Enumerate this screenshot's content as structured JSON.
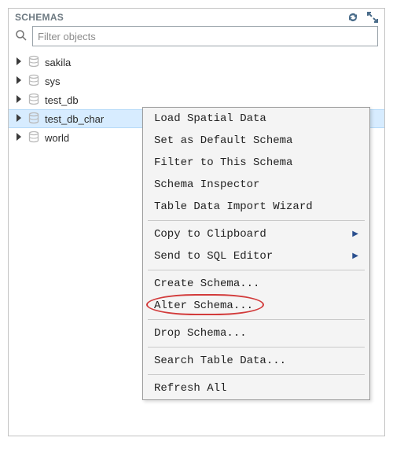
{
  "header": {
    "title": "SCHEMAS"
  },
  "search": {
    "placeholder": "Filter objects"
  },
  "schemas": [
    {
      "name": "sakila",
      "selected": false
    },
    {
      "name": "sys",
      "selected": false
    },
    {
      "name": "test_db",
      "selected": false
    },
    {
      "name": "test_db_char",
      "selected": true
    },
    {
      "name": "world",
      "selected": false
    }
  ],
  "context_menu": {
    "sections": [
      [
        {
          "label": "Load Spatial Data",
          "submenu": false,
          "highlight": false
        },
        {
          "label": "Set as Default Schema",
          "submenu": false,
          "highlight": false
        },
        {
          "label": "Filter to This Schema",
          "submenu": false,
          "highlight": false
        },
        {
          "label": "Schema Inspector",
          "submenu": false,
          "highlight": false
        },
        {
          "label": "Table Data Import Wizard",
          "submenu": false,
          "highlight": false
        }
      ],
      [
        {
          "label": "Copy to Clipboard",
          "submenu": true,
          "highlight": false
        },
        {
          "label": "Send to SQL Editor",
          "submenu": true,
          "highlight": false
        }
      ],
      [
        {
          "label": "Create Schema...",
          "submenu": false,
          "highlight": false
        },
        {
          "label": "Alter Schema...",
          "submenu": false,
          "highlight": true
        }
      ],
      [
        {
          "label": "Drop Schema...",
          "submenu": false,
          "highlight": false
        }
      ],
      [
        {
          "label": "Search Table Data...",
          "submenu": false,
          "highlight": false
        }
      ],
      [
        {
          "label": "Refresh All",
          "submenu": false,
          "highlight": false
        }
      ]
    ]
  },
  "colors": {
    "selection_bg": "#d7ecff",
    "highlight_ring": "#d23b3b"
  }
}
